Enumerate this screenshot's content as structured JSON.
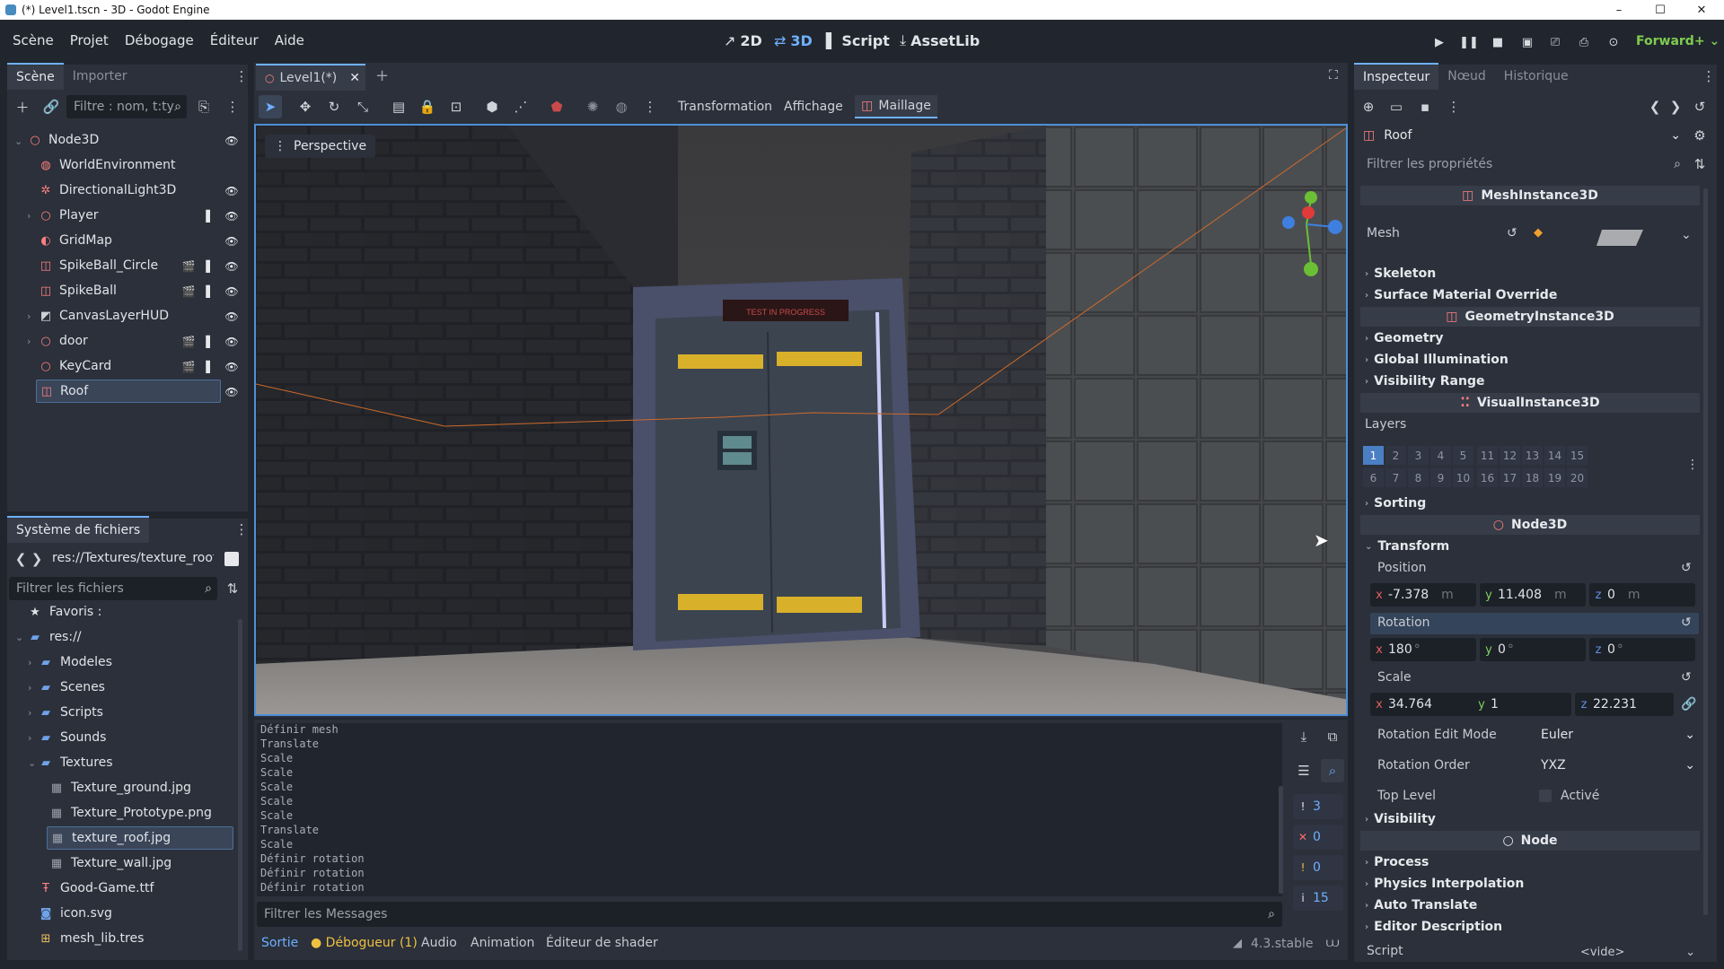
{
  "window": {
    "title": "(*) Level1.tscn - 3D - Godot Engine",
    "min": "–",
    "max": "☐",
    "close": "✕"
  },
  "menu": [
    "Scène",
    "Projet",
    "Débogage",
    "Éditeur",
    "Aide"
  ],
  "workspaces": [
    {
      "icon": "↗",
      "label": "2D"
    },
    {
      "icon": "⇄",
      "label": "3D"
    },
    {
      "icon": "▌",
      "label": "Script"
    },
    {
      "icon": "⤓",
      "label": "AssetLib"
    }
  ],
  "renderer": "Forward+",
  "scene_dock": {
    "tabs": [
      "Scène",
      "Importer"
    ],
    "filter_placeholder": "Filtre : nom, t:ty",
    "nodes": [
      {
        "name": "Node3D",
        "icon": "○",
        "color": "#fc7f7f",
        "fold": "⌄"
      },
      {
        "name": "WorldEnvironment",
        "icon": "◍",
        "color": "#fc7f7f"
      },
      {
        "name": "DirectionalLight3D",
        "icon": "✲",
        "color": "#fc7f7f"
      },
      {
        "name": "Player",
        "icon": "○",
        "color": "#fc7f7f",
        "fold": "›"
      },
      {
        "name": "GridMap",
        "icon": "◐",
        "color": "#fc7f7f"
      },
      {
        "name": "SpikeBall_Circle",
        "icon": "◫",
        "color": "#fc7f7f"
      },
      {
        "name": "SpikeBall",
        "icon": "◫",
        "color": "#fc7f7f"
      },
      {
        "name": "CanvasLayerHUD",
        "icon": "◩",
        "color": "#cfd3d9",
        "fold": "›"
      },
      {
        "name": "door",
        "icon": "○",
        "color": "#fc7f7f",
        "fold": "›"
      },
      {
        "name": "KeyCard",
        "icon": "○",
        "color": "#fc7f7f"
      },
      {
        "name": "Roof",
        "icon": "◫",
        "color": "#fc7f7f"
      }
    ]
  },
  "filesystem": {
    "title": "Système de fichiers",
    "path": "res://Textures/texture_roof.",
    "filter_placeholder": "Filtrer les fichiers",
    "items": [
      {
        "name": "Favoris :",
        "icon": "★",
        "color": "#e0e3e8"
      },
      {
        "name": "res://",
        "icon": "▰",
        "color": "#6fa2e8",
        "fold": "⌄"
      },
      {
        "name": "Modeles",
        "icon": "▰",
        "color": "#6fa2e8",
        "fold": "›"
      },
      {
        "name": "Scenes",
        "icon": "▰",
        "color": "#6fa2e8",
        "fold": "›"
      },
      {
        "name": "Scripts",
        "icon": "▰",
        "color": "#6fa2e8",
        "fold": "›"
      },
      {
        "name": "Sounds",
        "icon": "▰",
        "color": "#6fa2e8",
        "fold": "›"
      },
      {
        "name": "Textures",
        "icon": "▰",
        "color": "#6fa2e8",
        "fold": "⌄"
      },
      {
        "name": "Texture_ground.jpg",
        "icon": "▦",
        "color": "#9aa0aa"
      },
      {
        "name": "Texture_Prototype.png",
        "icon": "▦",
        "color": "#9aa0aa"
      },
      {
        "name": "texture_roof.jpg",
        "icon": "▦",
        "color": "#9aa0aa"
      },
      {
        "name": "Texture_wall.jpg",
        "icon": "▦",
        "color": "#9aa0aa"
      },
      {
        "name": "Good-Game.ttf",
        "icon": "Ŧ",
        "color": "#fc7f7f"
      },
      {
        "name": "icon.svg",
        "icon": "◙",
        "color": "#6fa2e8"
      },
      {
        "name": "mesh_lib.tres",
        "icon": "⊞",
        "color": "#f0c060"
      }
    ]
  },
  "editor": {
    "scene_tab": "Level1(*)",
    "add_tab": "+",
    "menus": [
      "Transformation",
      "Affichage",
      "Maillage"
    ],
    "viewport_label": "Perspective",
    "sign_text": "TEST IN PROGRESS"
  },
  "output": {
    "lines": [
      "Définir mesh",
      "Translate",
      "Scale",
      "Scale",
      "Scale",
      "Scale",
      "Scale",
      "Translate",
      "Scale",
      "Définir rotation",
      "Définir rotation",
      "Définir rotation"
    ],
    "filter_placeholder": "Filtrer les Messages",
    "counters": [
      {
        "icon": "!",
        "value": "3",
        "color": "#e6e8ec"
      },
      {
        "icon": "✕",
        "value": "0",
        "color": "#ff6b6b"
      },
      {
        "icon": "!",
        "value": "0",
        "color": "#f0c040"
      },
      {
        "icon": "i",
        "value": "15",
        "color": "#e6e8ec"
      }
    ],
    "tabs": [
      "Sortie",
      "Débogueur (1)",
      "Audio",
      "Animation",
      "Éditeur de shader"
    ],
    "version": "4.3.stable"
  },
  "inspector": {
    "tabs": [
      "Inspecteur",
      "Nœud",
      "Historique"
    ],
    "node": "Roof",
    "filter_placeholder": "Filtrer les propriétés",
    "sections": {
      "mesh_instance": "MeshInstance3D",
      "geometry_instance": "GeometryInstance3D",
      "visual_instance": "VisualInstance3D",
      "node3d": "Node3D",
      "node": "Node"
    },
    "mesh_label": "Mesh",
    "categories_a": [
      "Skeleton",
      "Surface Material Override"
    ],
    "categories_b": [
      "Geometry",
      "Global Illumination",
      "Visibility Range"
    ],
    "layers_label": "Layers",
    "layers_row1": [
      "1",
      "2",
      "3",
      "4",
      "5",
      "11",
      "12",
      "13",
      "14",
      "15"
    ],
    "layers_row2": [
      "6",
      "7",
      "8",
      "9",
      "10",
      "16",
      "17",
      "18",
      "19",
      "20"
    ],
    "sorting": "Sorting",
    "transform": "Transform",
    "position": {
      "label": "Position",
      "x": "-7.378",
      "y": "11.408",
      "z": "0",
      "unit": "m"
    },
    "rotation": {
      "label": "Rotation",
      "x": "180",
      "y": "0",
      "z": "0",
      "unit": "°"
    },
    "scale": {
      "label": "Scale",
      "x": "34.764",
      "y": "1",
      "z": "22.231"
    },
    "rotation_edit_mode": {
      "label": "Rotation Edit Mode",
      "value": "Euler"
    },
    "rotation_order": {
      "label": "Rotation Order",
      "value": "YXZ"
    },
    "top_level": {
      "label": "Top Level",
      "value": "Activé"
    },
    "visibility": "Visibility",
    "categories_c": [
      "Process",
      "Physics Interpolation",
      "Auto Translate",
      "Editor Description"
    ],
    "script": {
      "label": "Script",
      "value": "<vide>"
    }
  }
}
